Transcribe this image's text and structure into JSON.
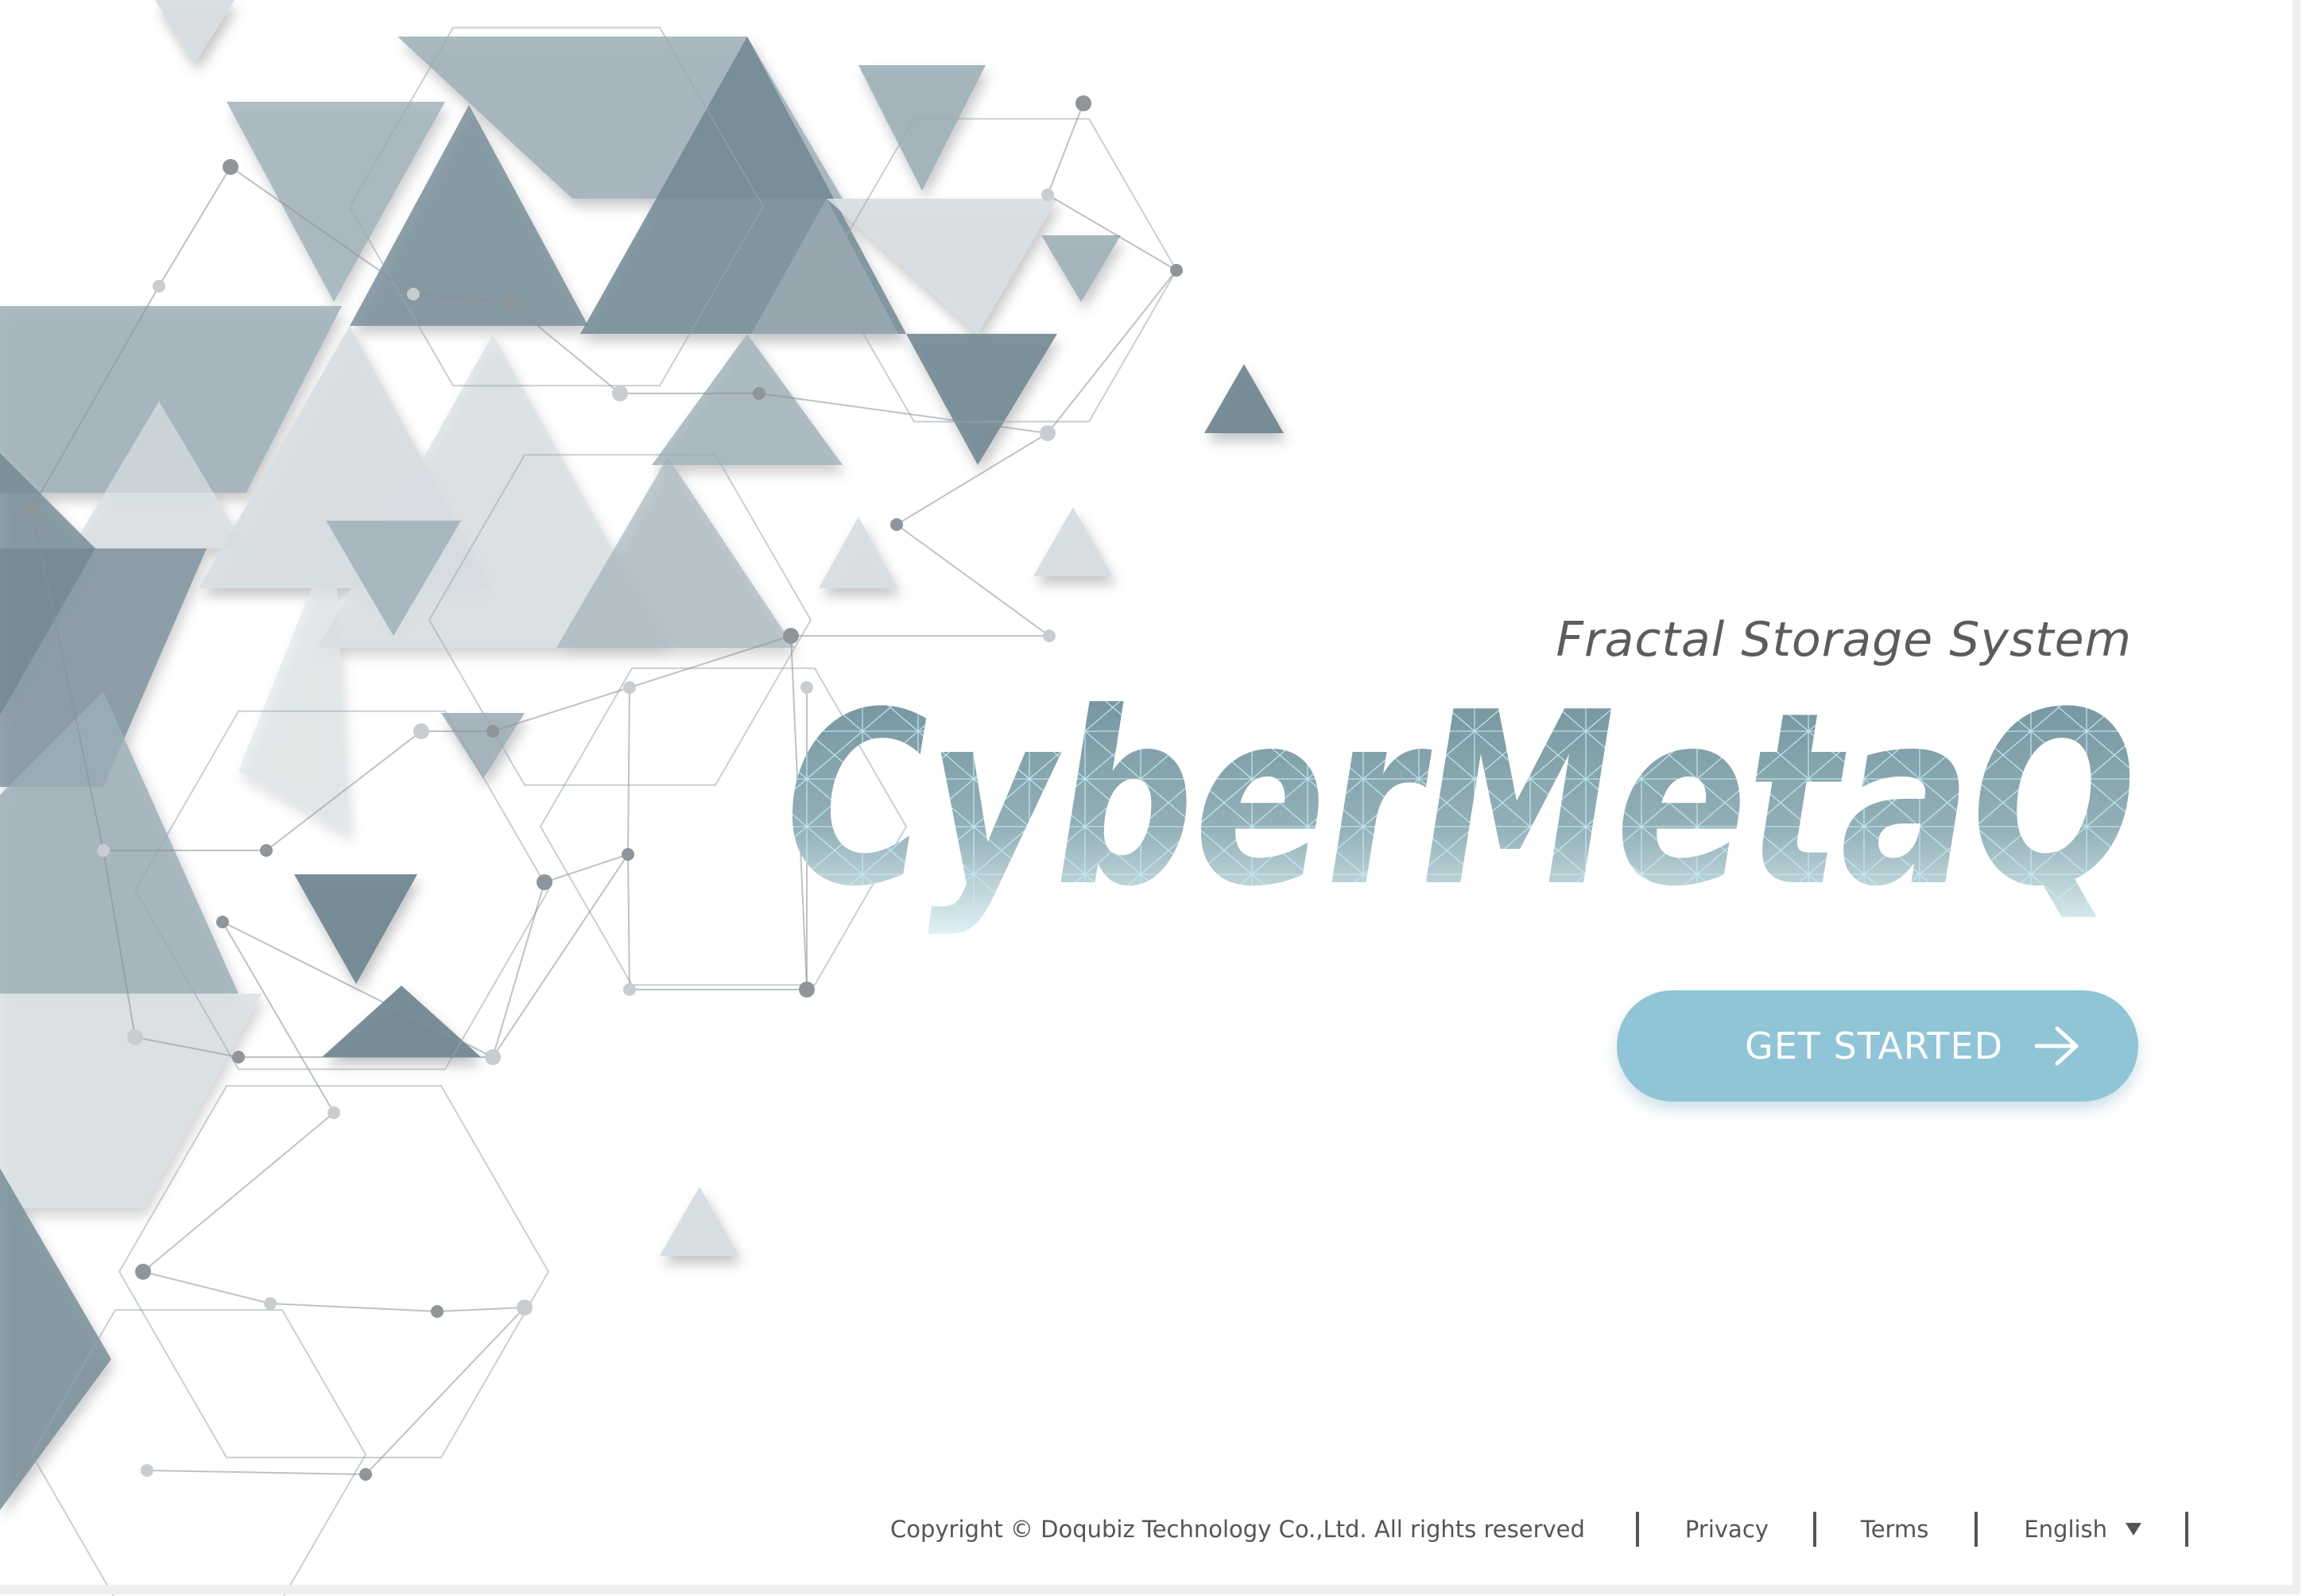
{
  "hero": {
    "subtitle": "Fractal Storage System",
    "brand_name": "CyberMetaQ",
    "cta_label": "GET STARTED",
    "cta_icon": "arrow-right-icon"
  },
  "footer": {
    "copyright": "Copyright © Doqubiz Technology Co.,Ltd. All rights reserved",
    "privacy": "Privacy",
    "terms": "Terms",
    "language": "English",
    "language_icon": "chevron-down-icon"
  },
  "colors": {
    "background": "#ffffff",
    "accent_button": "#8fc5d6",
    "brand_text_top": "#6f8f98",
    "brand_text_bottom": "#dff1f5",
    "brand_mesh": "#bfeaf2",
    "subtitle_text": "#5c5c5c",
    "footer_text": "#555555",
    "triangle_dark": "#728894",
    "triangle_mid": "#9eafb8",
    "triangle_light": "#d6dde1"
  }
}
